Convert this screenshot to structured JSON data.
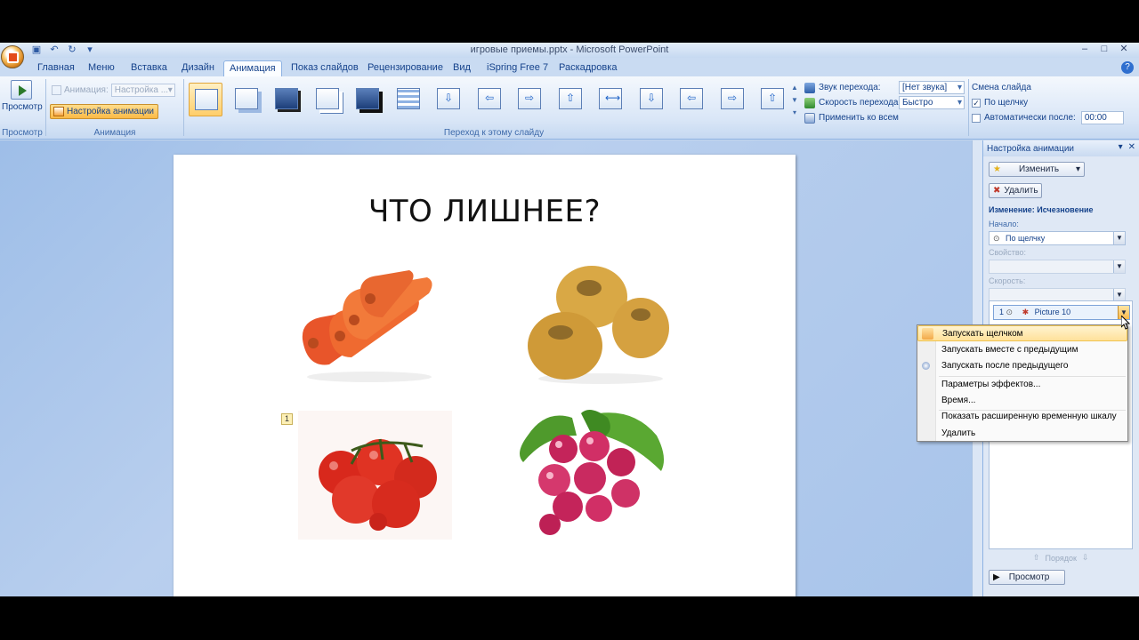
{
  "window": {
    "title": "игровые приемы.pptx - Microsoft PowerPoint",
    "minimize": "–",
    "maximize": "□",
    "close": "✕"
  },
  "tabs": [
    "Главная",
    "Меню",
    "Вставка",
    "Дизайн",
    "Анимация",
    "Показ слайдов",
    "Рецензирование",
    "Вид",
    "iSpring Free 7",
    "Раскадровка"
  ],
  "active_tab": "Анимация",
  "help": "?",
  "ribbon": {
    "preview_group": {
      "button": "Просмотр",
      "label": "Просмотр"
    },
    "animation_group": {
      "animation_label": "Анимация:",
      "animation_select": "Настройка ...",
      "custom_button": "Настройка анимации",
      "label": "Анимация"
    },
    "transition_group": {
      "label": "Переход к этому слайду",
      "sound_label": "Звук перехода:",
      "sound_value": "[Нет звука]",
      "speed_label": "Скорость перехода:",
      "speed_value": "Быстро",
      "apply_all": "Применить ко всем"
    },
    "advance": {
      "title": "Смена слайда",
      "on_click": "По щелчку",
      "on_click_checked": "✓",
      "after_label": "Автоматически после:",
      "after_value": "00:00"
    }
  },
  "slide": {
    "title": "ЧТО ЛИШНЕЕ?",
    "anim_tag": "1"
  },
  "taskpane": {
    "title": "Настройка анимации",
    "change_button": "Изменить",
    "delete_button": "Удалить",
    "change_heading": "Изменение: Исчезновение",
    "start_label": "Начало:",
    "start_value": "По щелчку",
    "property_label": "Свойство:",
    "speed_label": "Скорость:",
    "list_item_index": "1",
    "list_item_name": "Picture 10",
    "order_label": "Порядок",
    "preview_button": "Просмотр"
  },
  "context_menu": {
    "items": [
      "Запускать щелчком",
      "Запускать вместе с предыдущим",
      "Запускать после предыдущего",
      "Параметры эффектов...",
      "Время...",
      "Показать расширенную временную шкалу",
      "Удалить"
    ]
  },
  "colors": {
    "ribbon_text": "#15428b",
    "highlight": "#ffdd8c",
    "workspace": "#a8c4ea"
  }
}
